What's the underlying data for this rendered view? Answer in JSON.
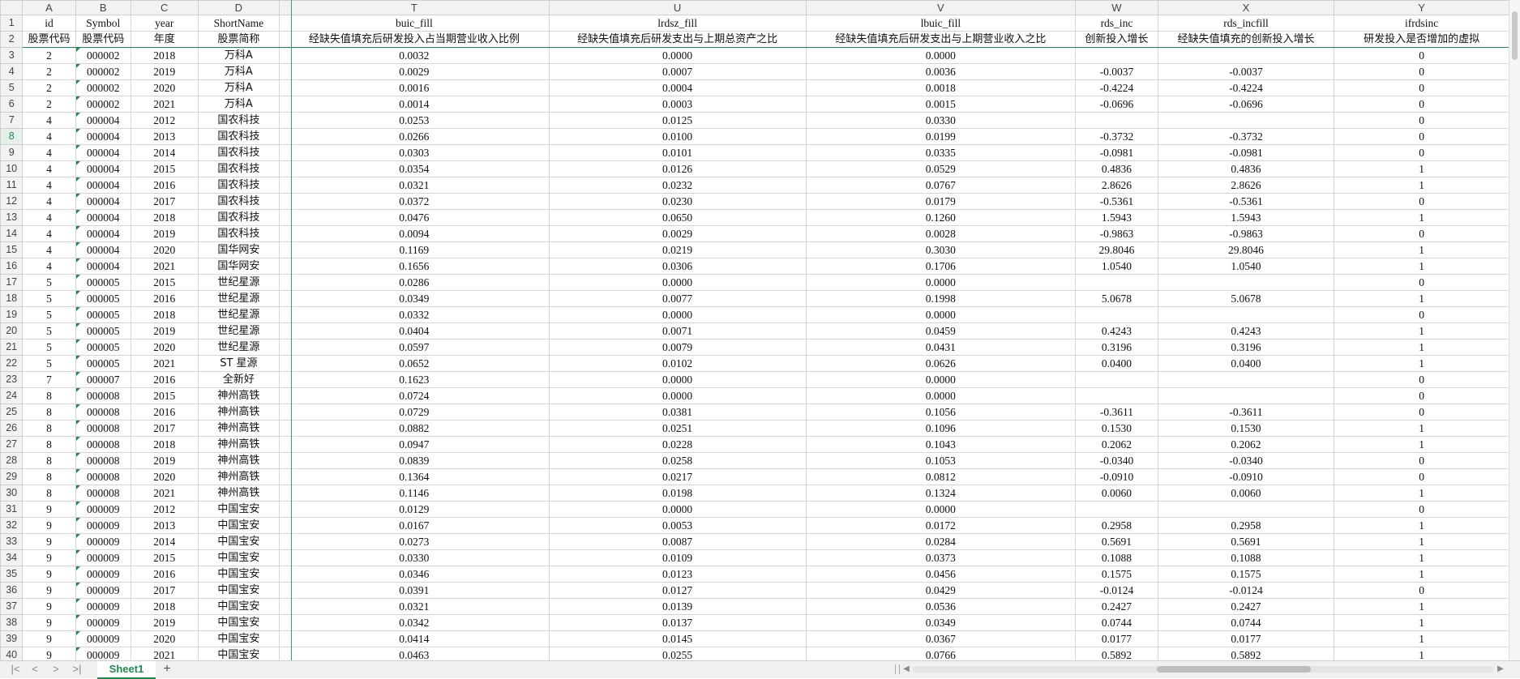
{
  "columns": [
    {
      "letter": "A",
      "w": 66,
      "field": "id",
      "desc": "股票代码"
    },
    {
      "letter": "B",
      "w": 69,
      "field": "Symbol",
      "desc": "股票代码"
    },
    {
      "letter": "C",
      "w": 87,
      "field": "year",
      "desc": "年度"
    },
    {
      "letter": "D",
      "w": 103,
      "field": "ShortName",
      "desc": "股票简称"
    },
    {
      "letter": "T",
      "w": 338,
      "field": "buic_fill",
      "desc": "经缺失值填充后研发投入占当期营业收入比例"
    },
    {
      "letter": "U",
      "w": 322,
      "field": "lrdsz_fill",
      "desc": "经缺失值填充后研发支出与上期总资产之比"
    },
    {
      "letter": "V",
      "w": 338,
      "field": "lbuic_fill",
      "desc": "经缺失值填充后研发支出与上期营业收入之比"
    },
    {
      "letter": "W",
      "w": 103,
      "field": "rds_inc",
      "desc": "创新投入增长"
    },
    {
      "letter": "X",
      "w": 221,
      "field": "rds_incfill",
      "desc": "经缺失值填充的创新投入增长"
    },
    {
      "letter": "Y",
      "w": 221,
      "field": "ifrdsinc",
      "desc": "研发投入是否增加的虚拟"
    }
  ],
  "selected_row": 8,
  "rows": [
    [
      "2",
      "000002",
      "2018",
      "万科A",
      "0.0032",
      "0.0000",
      "0.0000",
      "",
      "",
      "0"
    ],
    [
      "2",
      "000002",
      "2019",
      "万科A",
      "0.0029",
      "0.0007",
      "0.0036",
      "-0.0037",
      "-0.0037",
      "0"
    ],
    [
      "2",
      "000002",
      "2020",
      "万科A",
      "0.0016",
      "0.0004",
      "0.0018",
      "-0.4224",
      "-0.4224",
      "0"
    ],
    [
      "2",
      "000002",
      "2021",
      "万科A",
      "0.0014",
      "0.0003",
      "0.0015",
      "-0.0696",
      "-0.0696",
      "0"
    ],
    [
      "4",
      "000004",
      "2012",
      "国农科技",
      "0.0253",
      "0.0125",
      "0.0330",
      "",
      "",
      "0"
    ],
    [
      "4",
      "000004",
      "2013",
      "国农科技",
      "0.0266",
      "0.0100",
      "0.0199",
      "-0.3732",
      "-0.3732",
      "0"
    ],
    [
      "4",
      "000004",
      "2014",
      "国农科技",
      "0.0303",
      "0.0101",
      "0.0335",
      "-0.0981",
      "-0.0981",
      "0"
    ],
    [
      "4",
      "000004",
      "2015",
      "国农科技",
      "0.0354",
      "0.0126",
      "0.0529",
      "0.4836",
      "0.4836",
      "1"
    ],
    [
      "4",
      "000004",
      "2016",
      "国农科技",
      "0.0321",
      "0.0232",
      "0.0767",
      "2.8626",
      "2.8626",
      "1"
    ],
    [
      "4",
      "000004",
      "2017",
      "国农科技",
      "0.0372",
      "0.0230",
      "0.0179",
      "-0.5361",
      "-0.5361",
      "0"
    ],
    [
      "4",
      "000004",
      "2018",
      "国农科技",
      "0.0476",
      "0.0650",
      "0.1260",
      "1.5943",
      "1.5943",
      "1"
    ],
    [
      "4",
      "000004",
      "2019",
      "国农科技",
      "0.0094",
      "0.0029",
      "0.0028",
      "-0.9863",
      "-0.9863",
      "0"
    ],
    [
      "4",
      "000004",
      "2020",
      "国华网安",
      "0.1169",
      "0.0219",
      "0.3030",
      "29.8046",
      "29.8046",
      "1"
    ],
    [
      "4",
      "000004",
      "2021",
      "国华网安",
      "0.1656",
      "0.0306",
      "0.1706",
      "1.0540",
      "1.0540",
      "1"
    ],
    [
      "5",
      "000005",
      "2015",
      "世纪星源",
      "0.0286",
      "0.0000",
      "0.0000",
      "",
      "",
      "0"
    ],
    [
      "5",
      "000005",
      "2016",
      "世纪星源",
      "0.0349",
      "0.0077",
      "0.1998",
      "5.0678",
      "5.0678",
      "1"
    ],
    [
      "5",
      "000005",
      "2018",
      "世纪星源",
      "0.0332",
      "0.0000",
      "0.0000",
      "",
      "",
      "0"
    ],
    [
      "5",
      "000005",
      "2019",
      "世纪星源",
      "0.0404",
      "0.0071",
      "0.0459",
      "0.4243",
      "0.4243",
      "1"
    ],
    [
      "5",
      "000005",
      "2020",
      "世纪星源",
      "0.0597",
      "0.0079",
      "0.0431",
      "0.3196",
      "0.3196",
      "1"
    ],
    [
      "5",
      "000005",
      "2021",
      "ST 星源",
      "0.0652",
      "0.0102",
      "0.0626",
      "0.0400",
      "0.0400",
      "1"
    ],
    [
      "7",
      "000007",
      "2016",
      "全新好",
      "0.1623",
      "0.0000",
      "0.0000",
      "",
      "",
      "0"
    ],
    [
      "8",
      "000008",
      "2015",
      "神州高铁",
      "0.0724",
      "0.0000",
      "0.0000",
      "",
      "",
      "0"
    ],
    [
      "8",
      "000008",
      "2016",
      "神州高铁",
      "0.0729",
      "0.0381",
      "0.1056",
      "-0.3611",
      "-0.3611",
      "0"
    ],
    [
      "8",
      "000008",
      "2017",
      "神州高铁",
      "0.0882",
      "0.0251",
      "0.1096",
      "0.1530",
      "0.1530",
      "1"
    ],
    [
      "8",
      "000008",
      "2018",
      "神州高铁",
      "0.0947",
      "0.0228",
      "0.1043",
      "0.2062",
      "0.2062",
      "1"
    ],
    [
      "8",
      "000008",
      "2019",
      "神州高铁",
      "0.0839",
      "0.0258",
      "0.1053",
      "-0.0340",
      "-0.0340",
      "0"
    ],
    [
      "8",
      "000008",
      "2020",
      "神州高铁",
      "0.1364",
      "0.0217",
      "0.0812",
      "-0.0910",
      "-0.0910",
      "0"
    ],
    [
      "8",
      "000008",
      "2021",
      "神州高铁",
      "0.1146",
      "0.0198",
      "0.1324",
      "0.0060",
      "0.0060",
      "1"
    ],
    [
      "9",
      "000009",
      "2012",
      "中国宝安",
      "0.0129",
      "0.0000",
      "0.0000",
      "",
      "",
      "0"
    ],
    [
      "9",
      "000009",
      "2013",
      "中国宝安",
      "0.0167",
      "0.0053",
      "0.0172",
      "0.2958",
      "0.2958",
      "1"
    ],
    [
      "9",
      "000009",
      "2014",
      "中国宝安",
      "0.0273",
      "0.0087",
      "0.0284",
      "0.5691",
      "0.5691",
      "1"
    ],
    [
      "9",
      "000009",
      "2015",
      "中国宝安",
      "0.0330",
      "0.0109",
      "0.0373",
      "0.1088",
      "0.1088",
      "1"
    ],
    [
      "9",
      "000009",
      "2016",
      "中国宝安",
      "0.0346",
      "0.0123",
      "0.0456",
      "0.1575",
      "0.1575",
      "1"
    ],
    [
      "9",
      "000009",
      "2017",
      "中国宝安",
      "0.0391",
      "0.0127",
      "0.0429",
      "-0.0124",
      "-0.0124",
      "0"
    ],
    [
      "9",
      "000009",
      "2018",
      "中国宝安",
      "0.0321",
      "0.0139",
      "0.0536",
      "0.2427",
      "0.2427",
      "1"
    ],
    [
      "9",
      "000009",
      "2019",
      "中国宝安",
      "0.0342",
      "0.0137",
      "0.0349",
      "0.0744",
      "0.0744",
      "1"
    ],
    [
      "9",
      "000009",
      "2020",
      "中国宝安",
      "0.0414",
      "0.0145",
      "0.0367",
      "0.0177",
      "0.0177",
      "1"
    ],
    [
      "9",
      "000009",
      "2021",
      "中国宝安",
      "0.0463",
      "0.0255",
      "0.0766",
      "0.5892",
      "0.5892",
      "1"
    ]
  ],
  "sheet_tab": "Sheet1",
  "add_sheet": "+",
  "nav": [
    "|<",
    "<",
    ">",
    ">|"
  ],
  "icons": {
    "add_sheet": "plus-icon"
  }
}
